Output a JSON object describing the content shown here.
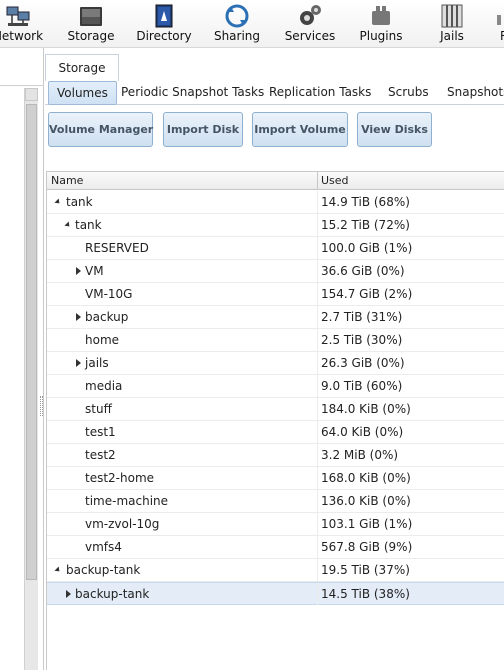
{
  "toolbar": {
    "items": [
      {
        "label": "Network",
        "icon": "network-icon"
      },
      {
        "label": "Storage",
        "icon": "storage-icon"
      },
      {
        "label": "Directory",
        "icon": "directory-icon"
      },
      {
        "label": "Sharing",
        "icon": "sharing-icon"
      },
      {
        "label": "Services",
        "icon": "services-icon"
      },
      {
        "label": "Plugins",
        "icon": "plugins-icon"
      },
      {
        "label": "Jails",
        "icon": "jails-icon"
      },
      {
        "label": "R",
        "icon": "reporting-icon"
      }
    ]
  },
  "main": {
    "outer_tab": "Storage",
    "subtabs": [
      "Volumes",
      "Periodic Snapshot Tasks",
      "Replication Tasks",
      "Scrubs",
      "Snapshots"
    ],
    "active_subtab": "Volumes",
    "buttons": [
      "Volume Manager",
      "Import Disk",
      "Import Volume",
      "View Disks"
    ],
    "grid": {
      "columns": [
        "Name",
        "Used"
      ],
      "rows": [
        {
          "name": "tank",
          "used": "14.9 TiB (68%)",
          "level": 0,
          "expander": "expanded"
        },
        {
          "name": "tank",
          "used": "15.2 TiB (72%)",
          "level": 1,
          "expander": "expanded"
        },
        {
          "name": "RESERVED",
          "used": "100.0 GiB (1%)",
          "level": 2,
          "expander": "none"
        },
        {
          "name": "VM",
          "used": "36.6 GiB (0%)",
          "level": 2,
          "expander": "collapsed"
        },
        {
          "name": "VM-10G",
          "used": "154.7 GiB (2%)",
          "level": 2,
          "expander": "none"
        },
        {
          "name": "backup",
          "used": "2.7 TiB (31%)",
          "level": 2,
          "expander": "collapsed"
        },
        {
          "name": "home",
          "used": "2.5 TiB (30%)",
          "level": 2,
          "expander": "none"
        },
        {
          "name": "jails",
          "used": "26.3 GiB (0%)",
          "level": 2,
          "expander": "collapsed"
        },
        {
          "name": "media",
          "used": "9.0 TiB (60%)",
          "level": 2,
          "expander": "none"
        },
        {
          "name": "stuff",
          "used": "184.0 KiB (0%)",
          "level": 2,
          "expander": "none"
        },
        {
          "name": "test1",
          "used": "64.0 KiB (0%)",
          "level": 2,
          "expander": "none"
        },
        {
          "name": "test2",
          "used": "3.2 MiB (0%)",
          "level": 2,
          "expander": "none"
        },
        {
          "name": "test2-home",
          "used": "168.0 KiB (0%)",
          "level": 2,
          "expander": "none"
        },
        {
          "name": "time-machine",
          "used": "136.0 KiB (0%)",
          "level": 2,
          "expander": "none"
        },
        {
          "name": "vm-zvol-10g",
          "used": "103.1 GiB (1%)",
          "level": 2,
          "expander": "none"
        },
        {
          "name": "vmfs4",
          "used": "567.8 GiB (9%)",
          "level": 2,
          "expander": "none"
        },
        {
          "name": "backup-tank",
          "used": "19.5 TiB (37%)",
          "level": 0,
          "expander": "expanded"
        },
        {
          "name": "backup-tank",
          "used": "14.5 TiB (38%)",
          "level": 1,
          "expander": "collapsed",
          "selected": true
        }
      ]
    }
  }
}
